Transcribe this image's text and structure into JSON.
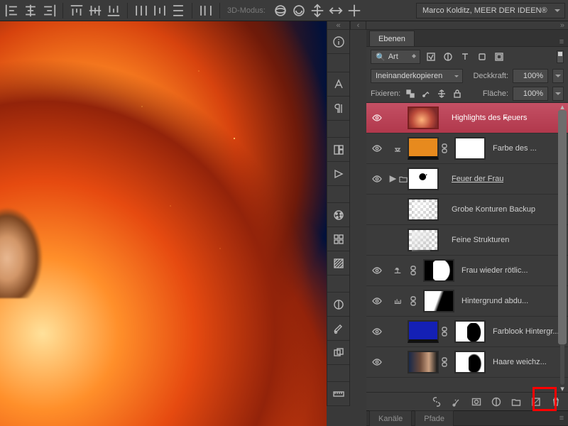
{
  "topbar": {
    "mode_label": "3D-Modus:",
    "user": "Marco Kolditz, MEER DER IDEEN®"
  },
  "panel": {
    "layers_tab": "Ebenen",
    "channels_tab": "Kanäle",
    "paths_tab": "Pfade",
    "kind_filter": "Art",
    "blend_mode": "Ineinanderkopieren",
    "opacity_label": "Deckkraft:",
    "opacity_value": "100%",
    "lock_label": "Fixieren:",
    "fill_label": "Fläche:",
    "fill_value": "100%"
  },
  "layers": [
    {
      "name": "Highlights des Feuers"
    },
    {
      "name": "Farbe des ..."
    },
    {
      "name": "Feuer der Frau "
    },
    {
      "name": "Grobe Konturen Backup"
    },
    {
      "name": "Feine Strukturen"
    },
    {
      "name": "Frau wieder rötlic..."
    },
    {
      "name": "Hintergrund abdu..."
    },
    {
      "name": "Farblook Hintergr..."
    },
    {
      "name": "Haare weichz..."
    }
  ]
}
